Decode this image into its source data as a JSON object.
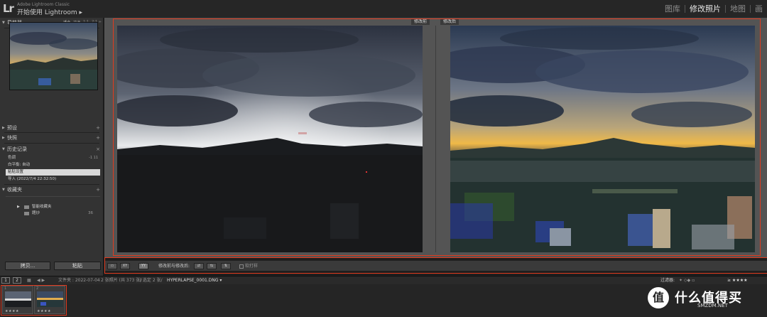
{
  "app": {
    "logo": "Lr",
    "subtitle": "Adobe Lightroom Classic",
    "title": "开始使用 Lightroom ▸",
    "modules": [
      "图库",
      "修改照片",
      "地图",
      "画"
    ],
    "active_module": 1
  },
  "left_panel": {
    "navigator": {
      "title": "导航器",
      "options": [
        "适合",
        "填满",
        "1:1",
        "2:1 ÷"
      ]
    },
    "presets": {
      "title": "预设",
      "plus": "+"
    },
    "snapshots": {
      "title": "快照",
      "plus": "+"
    },
    "history": {
      "title": "历史记录",
      "close": "×",
      "items": [
        {
          "label": "色调",
          "num": "-1    11"
        },
        {
          "label": "白平衡: 自动",
          "num": ""
        },
        {
          "label": "粘贴设置",
          "num": ""
        },
        {
          "label": "导入 (2022/7/4 22:32:50)",
          "num": ""
        }
      ],
      "selected_index": 2
    },
    "collections": {
      "title": "收藏夹",
      "plus": "+",
      "items": [
        {
          "label": "智能收藏夹",
          "num": ""
        },
        {
          "label": "题炒",
          "num": "36"
        }
      ]
    },
    "copy_button": "拷贝...",
    "paste_button": "粘贴"
  },
  "compare": {
    "before_tag": "修改前",
    "after_tag": "修改后"
  },
  "compare_toolbar": {
    "btn1": "▭",
    "btn2": "XY",
    "btn3": "YY",
    "label": "修改前与修改后:",
    "proof_label": "软打样"
  },
  "info_bar": {
    "page1": "1",
    "page2": "2",
    "nav": "◀ ▶",
    "folder": "文件夹 : 2022-07-04",
    "count": "2 张照片 (共 373 张)",
    "selected": "/ 选定 2 张/",
    "filename": "HYPERLAPSE_0001.DNG ▾",
    "filter_label": "过滤器:",
    "rating": "≥ ★★★★"
  },
  "filmstrip": {
    "thumbs": [
      {
        "index": "1",
        "stars": "★★★★"
      },
      {
        "index": "2",
        "stars": "★★★★"
      }
    ]
  },
  "watermark": {
    "circle": "值",
    "text": "什么值得买",
    "sub": "SMZDM.NET"
  },
  "colors": {
    "highlight": "#e03a1e",
    "panel": "#333333",
    "main_bg": "#545454"
  }
}
